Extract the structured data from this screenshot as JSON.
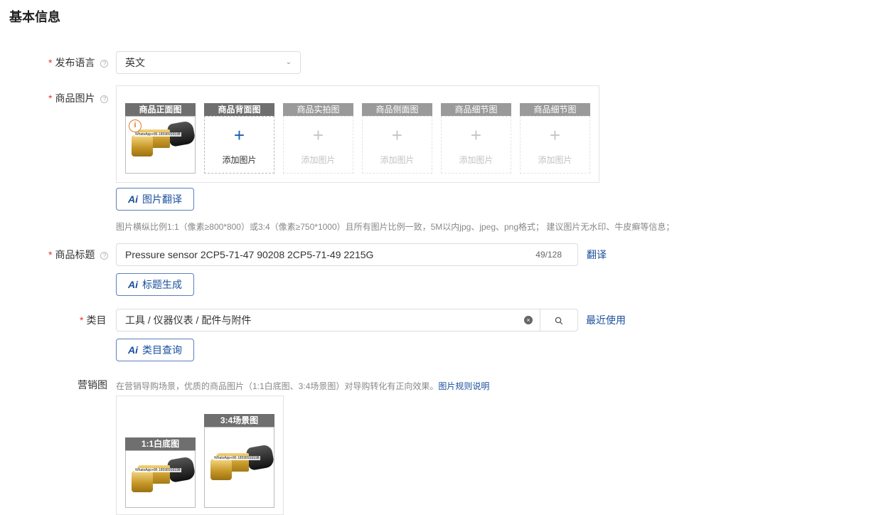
{
  "section": {
    "title": "基本信息"
  },
  "language": {
    "label": "发布语言",
    "value": "英文"
  },
  "images": {
    "label": "商品图片",
    "slots": [
      {
        "tag": "商品正面图",
        "watermark": "WhatsApp+86 18598919198"
      },
      {
        "tag": "商品背面图",
        "add_text": "添加图片"
      },
      {
        "tag": "商品实拍图",
        "add_text": "添加图片"
      },
      {
        "tag": "商品侧面图",
        "add_text": "添加图片"
      },
      {
        "tag": "商品细节图",
        "add_text": "添加图片"
      },
      {
        "tag": "商品细节图",
        "add_text": "添加图片"
      }
    ],
    "translate_button": "图片翻译",
    "hint": "图片横纵比例1:1（像素≥800*800）或3:4（像素≥750*1000）且所有图片比例一致，5M以内jpg、jpeg、png格式； 建议图片无水印、牛皮癣等信息；"
  },
  "title_field": {
    "label": "商品标题",
    "value": "Pressure sensor 2CP5-71-47 90208 2CP5-71-49 2215G",
    "count": "49/128",
    "translate_link": "翻译",
    "generate_button": "标题生成"
  },
  "category": {
    "label": "类目",
    "value": "工具 / 仪器仪表 / 配件与附件",
    "recent_link": "最近使用",
    "query_button": "类目查询"
  },
  "marketing": {
    "label": "营销图",
    "desc": "在营销导购场景，优质的商品图片（1:1白底图、3:4场景图）对导购转化有正向效果。",
    "rules_link": "图片规则说明",
    "slots": [
      {
        "tag": "1:1白底图",
        "watermark": "WhatsApp+86 18598919198"
      },
      {
        "tag": "3:4场景图",
        "watermark": "WhatsApp+86 18598919198"
      }
    ]
  },
  "ai_mark": "Ai",
  "icons": {
    "help": "question-circle-icon",
    "chevron": "chevron-down-icon",
    "warning": "info-circle-icon",
    "plus": "plus-icon",
    "clear": "clear-circle-icon",
    "search": "search-icon"
  },
  "colors": {
    "required": "#e5352b",
    "link": "#1a4f9c",
    "tag_bg": "#6f6f6f",
    "warning": "#e07a2c"
  }
}
